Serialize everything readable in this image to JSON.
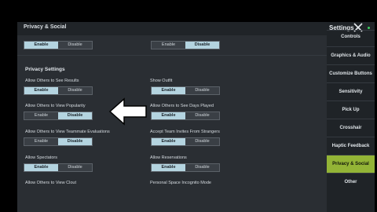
{
  "header": {
    "title": "Privacy & Social"
  },
  "settings_title": "Settings",
  "sidebar": {
    "items": [
      {
        "label": "Controls",
        "active": false
      },
      {
        "label": "Graphics & Audio",
        "active": false
      },
      {
        "label": "Customize Buttons",
        "active": false
      },
      {
        "label": "Sensitivity",
        "active": false
      },
      {
        "label": "Pick Up",
        "active": false
      },
      {
        "label": "Crosshair",
        "active": false
      },
      {
        "label": "Haptic Feedback",
        "active": false
      },
      {
        "label": "Privacy & Social",
        "active": true
      },
      {
        "label": "Other",
        "active": false
      }
    ]
  },
  "top_toggles": {
    "left": {
      "enable": "Enable",
      "disable": "Disable",
      "selected": "enable"
    },
    "right": {
      "enable": "Enable",
      "disable": "Disable",
      "selected": "disable"
    }
  },
  "privacy": {
    "heading": "Privacy Settings",
    "items": [
      {
        "label": "Allow Others to See Results",
        "enable": "Enable",
        "disable": "Disable",
        "selected": "enable"
      },
      {
        "label": "Show Outfit",
        "enable": "Enable",
        "disable": "Disable",
        "selected": "enable"
      },
      {
        "label": "Allow Others to View Popularity",
        "enable": "Enable",
        "disable": "Disable",
        "selected": "disable"
      },
      {
        "label": "Allow Others to See Days Played",
        "enable": "Enable",
        "disable": "Disable",
        "selected": "enable"
      },
      {
        "label": "Allow Others to View Teammate Evaluations",
        "enable": "Enable",
        "disable": "Disable",
        "selected": "disable"
      },
      {
        "label": "Accept Team Invites From Strangers",
        "enable": "Enable",
        "disable": "Disable",
        "selected": "enable"
      },
      {
        "label": "Allow Spectators",
        "enable": "Enable",
        "disable": "Disable",
        "selected": "enable"
      },
      {
        "label": "Allow Reservations",
        "enable": "Enable",
        "disable": "Disable",
        "selected": "enable"
      },
      {
        "label": "Allow Others to View Clout"
      },
      {
        "label": "Personal Space Incognito Mode"
      }
    ]
  }
}
